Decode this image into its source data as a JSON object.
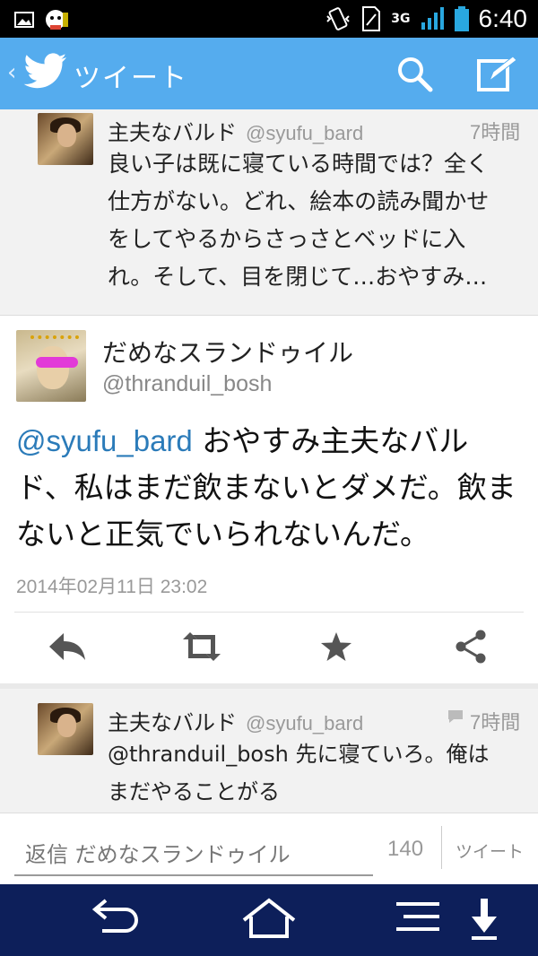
{
  "status_bar": {
    "network": "3G",
    "time": "6:40",
    "icons": [
      "gallery-icon",
      "mascot-icon",
      "vibrate-icon",
      "sim-icon",
      "signal-icon",
      "battery-icon"
    ]
  },
  "action_bar": {
    "back_glyph": "‹",
    "title": "ツイート",
    "icons": [
      "twitter-bird-icon",
      "search-icon",
      "compose-icon"
    ],
    "color": "#55acee"
  },
  "tweets": {
    "previous": {
      "name": "主夫なバルド",
      "handle": "@syufu_bard",
      "time": "7時間",
      "lines": [
        "良い子は既に寝ている時間では？全く",
        "仕方がない。どれ、絵本の読み聞かせ",
        "をしてやるからさっさとベッドに入",
        "れ。そして、目を閉じて…おやすみ…"
      ]
    },
    "main": {
      "name": "だめなスランドゥイル",
      "handle": "@thranduil_bosh",
      "mention": "@syufu_bard",
      "text_line1": " おやすみ主夫なバル",
      "text_line2": "ド、私はまだ飲まないとダメだ。飲ま",
      "text_line3": "ないと正気でいられないんだ。",
      "date": "2014年02月11日 23:02",
      "mention_color": "#2b7bb9"
    },
    "reply": {
      "name": "主夫なバルド",
      "handle": "@syufu_bard",
      "time": "7時間",
      "line1": "@thranduil_bosh 先に寝ていろ。俺は",
      "line2": "まだやることがる"
    }
  },
  "actions": {
    "icons": [
      "reply-icon",
      "retweet-icon",
      "favorite-icon",
      "share-icon"
    ]
  },
  "reply_bar": {
    "placeholder": "返信 だめなスランドゥイル",
    "count": "140",
    "tweet_button": "ツイート"
  },
  "nav_bar": {
    "icons": [
      "back-icon",
      "home-icon",
      "menu-icon",
      "download-icon"
    ],
    "color": "#0d1f5a"
  }
}
